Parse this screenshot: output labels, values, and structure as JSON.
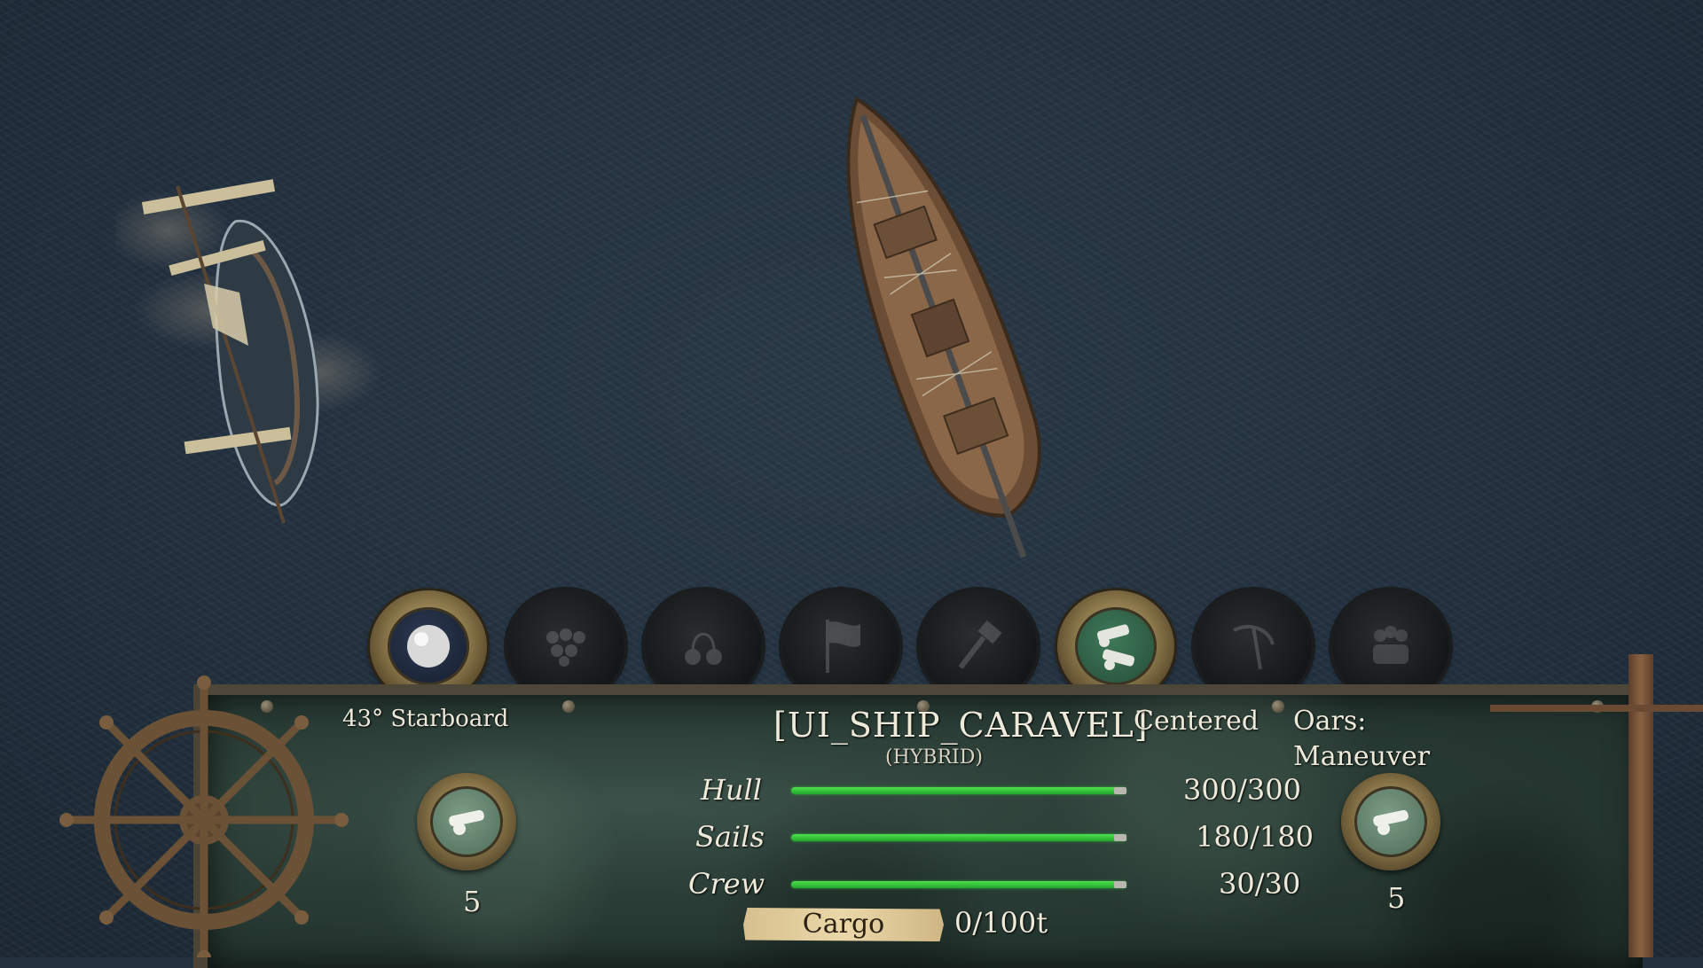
{
  "abilities": [
    {
      "name": "round-shot",
      "active": true
    },
    {
      "name": "grape-shot",
      "active": false
    },
    {
      "name": "chain-shot",
      "active": false
    },
    {
      "name": "flag",
      "active": false
    },
    {
      "name": "repair-hammer",
      "active": false
    },
    {
      "name": "broadside-cannons",
      "active": true
    },
    {
      "name": "grappling-hook",
      "active": false
    },
    {
      "name": "boarding-crew",
      "active": false
    }
  ],
  "panel": {
    "angle_text": "43° Starboard",
    "ship_name": "[UI_SHIP_CARAVEL]",
    "ship_type": "(HYBRID)",
    "camera_mode": "Centered",
    "oars_label": "Oars:",
    "oars_mode": "Maneuver",
    "left_cannon_count": "5",
    "right_cannon_count": "5",
    "stats": [
      {
        "label": "Hull",
        "value": "300/300",
        "fraction": 1.0
      },
      {
        "label": "Sails",
        "value": "180/180",
        "fraction": 1.0
      },
      {
        "label": "Crew",
        "value": "30/30",
        "fraction": 1.0
      }
    ],
    "cargo_label": "Cargo",
    "cargo_value": "0/100t"
  },
  "colors": {
    "health_bar": "#3ccf44",
    "panel_bg": "#2a3d36",
    "sea": "#24323f",
    "text": "#efe9da"
  }
}
